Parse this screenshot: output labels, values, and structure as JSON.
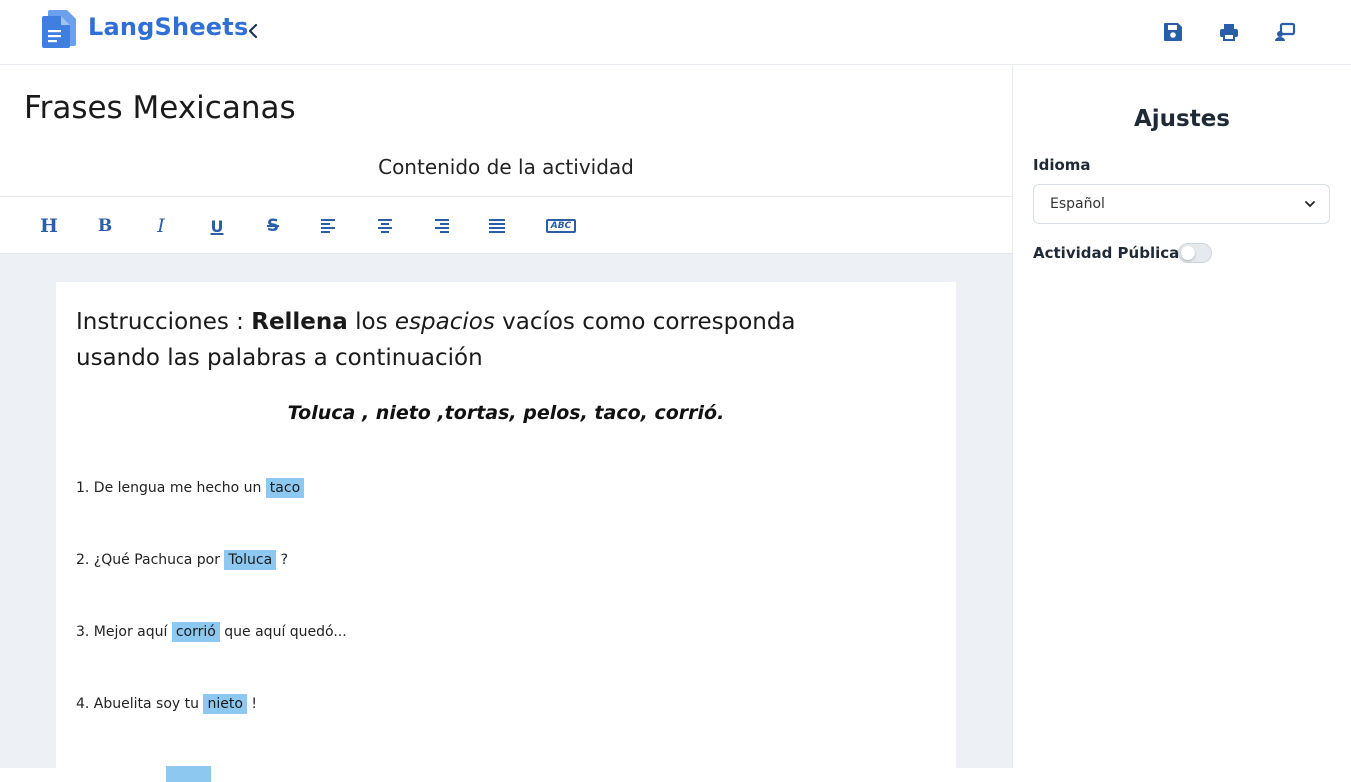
{
  "app": {
    "brand": "LangSheets",
    "logo_icon": "document-icon",
    "accent_color": "#2f6fd6"
  },
  "header_actions": [
    {
      "name": "save-icon"
    },
    {
      "name": "print-icon"
    },
    {
      "name": "share-icon"
    }
  ],
  "activity": {
    "title": "Frases Mexicanas",
    "content_heading": "Contenido de la actividad"
  },
  "toolbar": {
    "heading": "H",
    "bold": "B",
    "italic": "I",
    "underline": "U",
    "strike": "S",
    "fill_blank": "ABC"
  },
  "sheet": {
    "instructions_prefix": "Instrucciones : ",
    "instructions_bold": "Rellena",
    "instructions_mid": " los ",
    "instructions_italic": "espacios",
    "instructions_suffix": " vacíos como corresponda usando las palabras a continuación",
    "word_bank": "Toluca , nieto ,tortas, pelos, taco, corrió.",
    "items": [
      {
        "before": "1. De lengua me hecho un ",
        "blank": "taco",
        "after": ""
      },
      {
        "before": "2. ¿Qué Pachuca por ",
        "blank": "Toluca",
        "after": " ?"
      },
      {
        "before": "3. Mejor aquí ",
        "blank": "corrió",
        "after": " que aquí quedó..."
      },
      {
        "before": "4.  Abuelita soy tu ",
        "blank": "nieto",
        "after": " !"
      }
    ]
  },
  "settings": {
    "title": "Ajustes",
    "language_label": "Idioma",
    "language_value": "Español",
    "public_label": "Actividad Pública",
    "public_enabled": false
  }
}
